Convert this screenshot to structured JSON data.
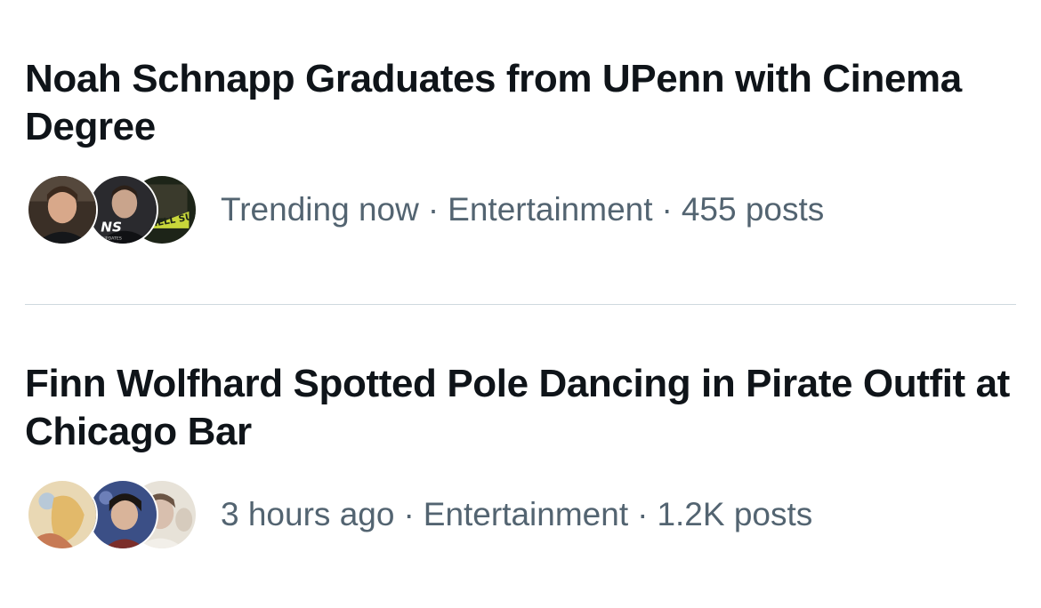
{
  "trends": [
    {
      "title": "Noah Schnapp Graduates from UPenn with Cinema Degree",
      "time": "Trending now",
      "category": "Entertainment",
      "posts": "455 posts",
      "avatar_overlays": {
        "a2": "NS",
        "a2_small": "UPDATES",
        "a3": "HELL SUMMER"
      }
    },
    {
      "title": "Finn Wolfhard Spotted Pole Dancing in Pirate Outfit at Chicago Bar",
      "time": "3 hours ago",
      "category": "Entertainment",
      "posts": "1.2K posts"
    }
  ],
  "separator": "·",
  "colors": {
    "title": "#0f1419",
    "meta": "#536471",
    "divider": "#cfd9de",
    "background": "#ffffff"
  }
}
